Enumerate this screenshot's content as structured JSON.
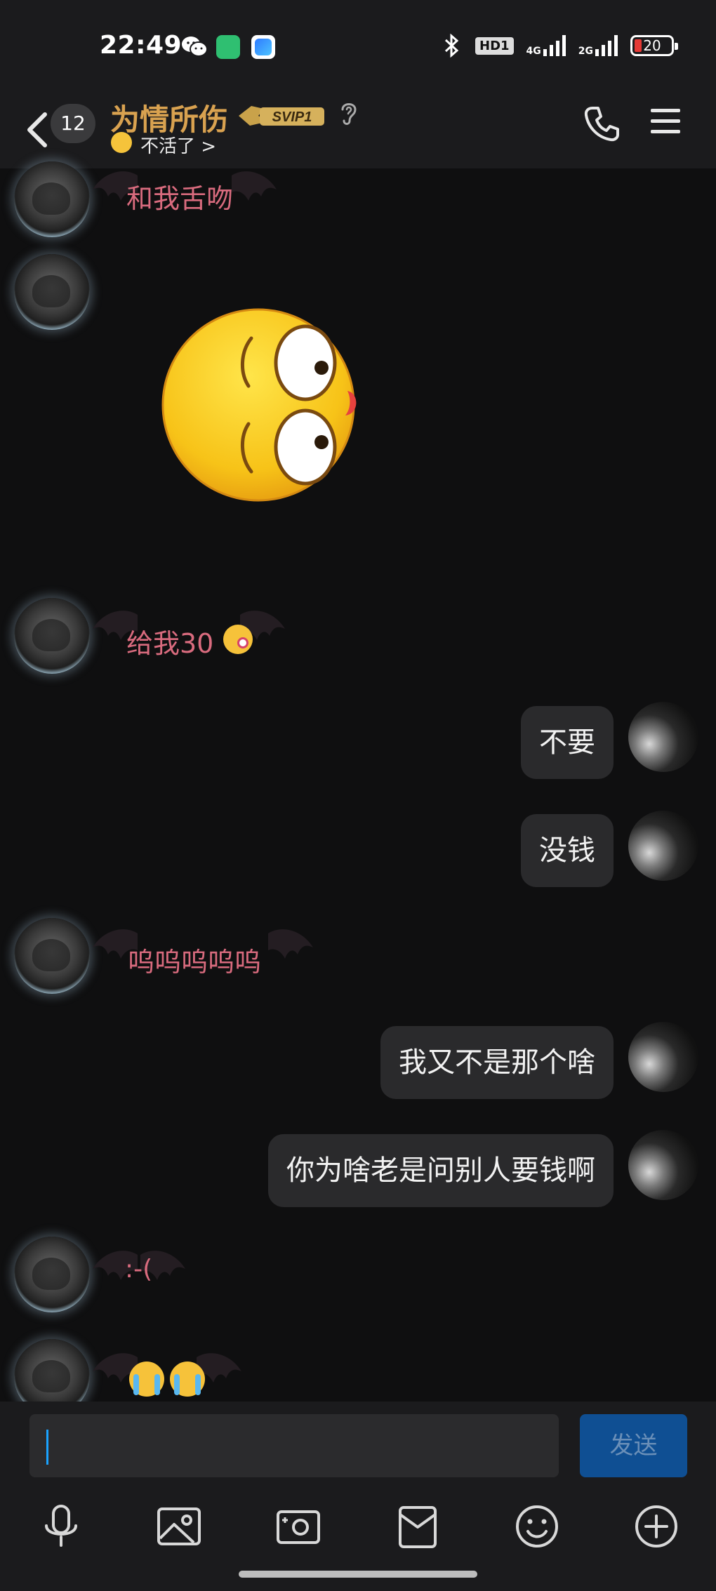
{
  "status_bar": {
    "time": "22:49",
    "hd_label": "HD1",
    "net1_label": "4G",
    "net2_label": "2G",
    "battery_level": "20"
  },
  "header": {
    "unread_count": "12",
    "contact_name": "为情所伤",
    "svip_label": "SVIP1",
    "status_text": "不活了 >"
  },
  "messages": [
    {
      "side": "left",
      "style": "bat",
      "text": "和我舌吻"
    },
    {
      "side": "left",
      "style": "sticker",
      "icon": "googly-eye-emoji-sticker"
    },
    {
      "side": "left",
      "style": "bat",
      "text": "给我30",
      "emoji": "yum-face-emoji"
    },
    {
      "side": "right",
      "text": "不要"
    },
    {
      "side": "right",
      "text": "没钱"
    },
    {
      "side": "left",
      "style": "bat",
      "text": "呜呜呜呜呜"
    },
    {
      "side": "right",
      "text": "我又不是那个啥"
    },
    {
      "side": "right",
      "text": "你为啥老是问别人要钱啊"
    },
    {
      "side": "left",
      "style": "bat",
      "text": ":-("
    },
    {
      "side": "left",
      "style": "bat",
      "emoji": "loudly-crying-emoji x2"
    }
  ],
  "input": {
    "send_label": "发送"
  },
  "toolbar": [
    "microphone-icon",
    "image-icon",
    "camera-icon",
    "red-packet-icon",
    "emoji-icon",
    "plus-icon"
  ],
  "colors": {
    "background": "#0f0f10",
    "bar": "#1b1b1d",
    "name_gold": "#d9a250",
    "bat_text_pink": "#d96b7e",
    "send_button": "#0f4f93",
    "caret": "#1aa3ff"
  }
}
